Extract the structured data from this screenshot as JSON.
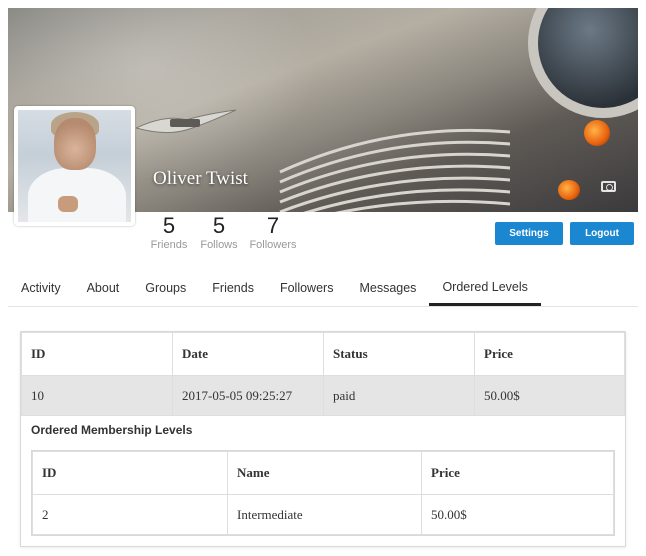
{
  "profile": {
    "name": "Oliver Twist",
    "stats": [
      {
        "value": "5",
        "label": "Friends"
      },
      {
        "value": "5",
        "label": "Follows"
      },
      {
        "value": "7",
        "label": "Followers"
      }
    ]
  },
  "actions": {
    "settings": "Settings",
    "logout": "Logout"
  },
  "tabs": [
    "Activity",
    "About",
    "Groups",
    "Friends",
    "Followers",
    "Messages",
    "Ordered Levels"
  ],
  "active_tab": "Ordered Levels",
  "orders": {
    "columns": [
      "ID",
      "Date",
      "Status",
      "Price"
    ],
    "rows": [
      [
        "10",
        "2017-05-05 09:25:27",
        "paid",
        "50.00$"
      ]
    ]
  },
  "levels": {
    "title": "Ordered Membership Levels",
    "columns": [
      "ID",
      "Name",
      "Price"
    ],
    "rows": [
      [
        "2",
        "Intermediate",
        "50.00$"
      ]
    ]
  },
  "colors": {
    "accent": "#1a87d0",
    "active_tab_border": "#222222"
  },
  "icons": {
    "cover_camera": "camera-icon"
  }
}
